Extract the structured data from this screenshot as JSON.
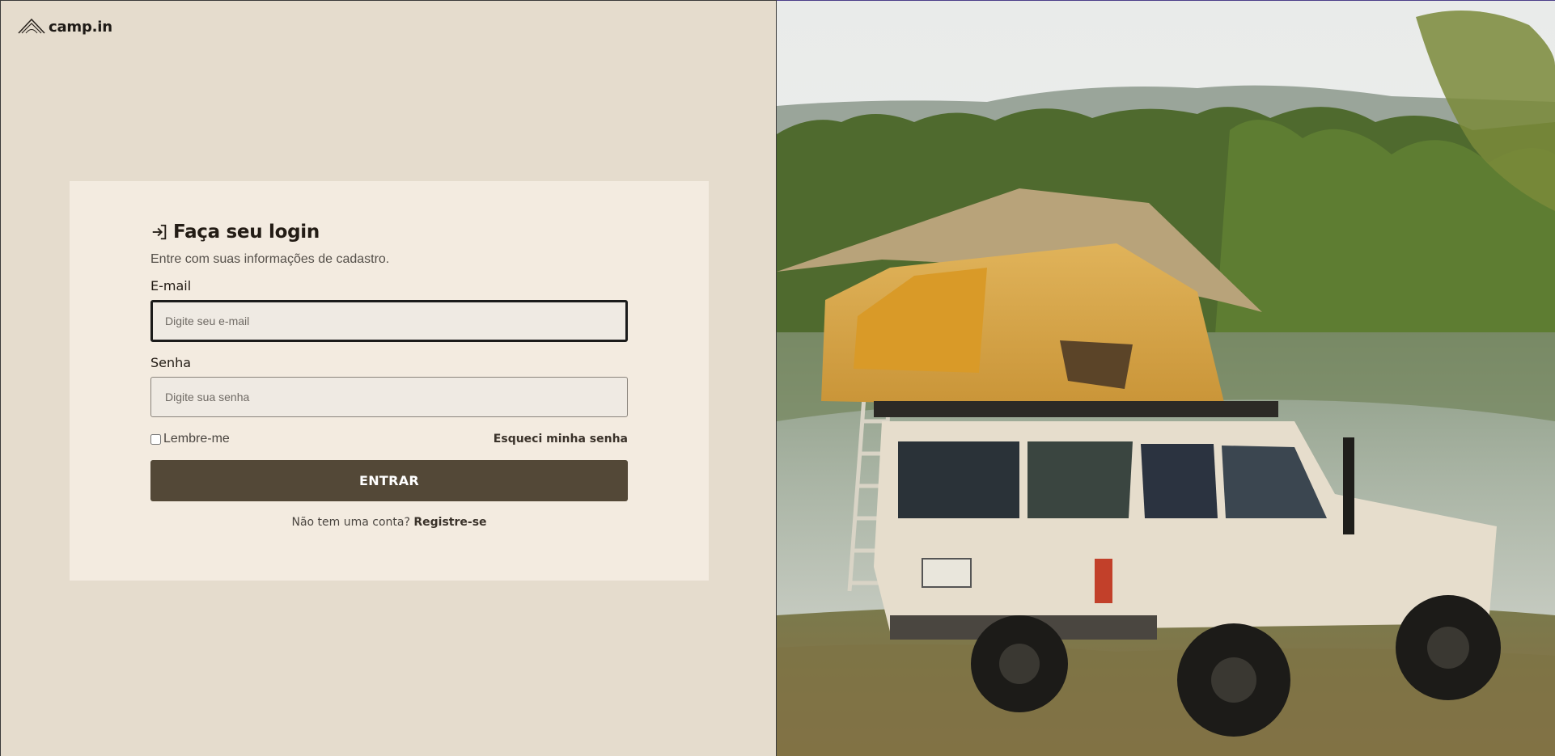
{
  "brand": {
    "name": "camp.in",
    "icon": "tent-logo-icon"
  },
  "login": {
    "icon": "sign-in-icon",
    "title": "Faça seu login",
    "subtitle": "Entre com suas informações de cadastro.",
    "email_label": "E-mail",
    "email_placeholder": "Digite seu e-mail",
    "email_value": "",
    "password_label": "Senha",
    "password_placeholder": "Digite sua senha",
    "password_value": "",
    "remember_label": "Lembre-me",
    "remember_checked": false,
    "forgot_label": "Esqueci minha senha",
    "submit_label": "ENTRAR",
    "signup_prompt": "Não tem uma conta?",
    "signup_link": "Registre-se"
  },
  "colors": {
    "page_bg": "#e5dccd",
    "card_bg": "#f3ebe0",
    "button_bg": "#534837",
    "text_dark": "#231c15"
  }
}
